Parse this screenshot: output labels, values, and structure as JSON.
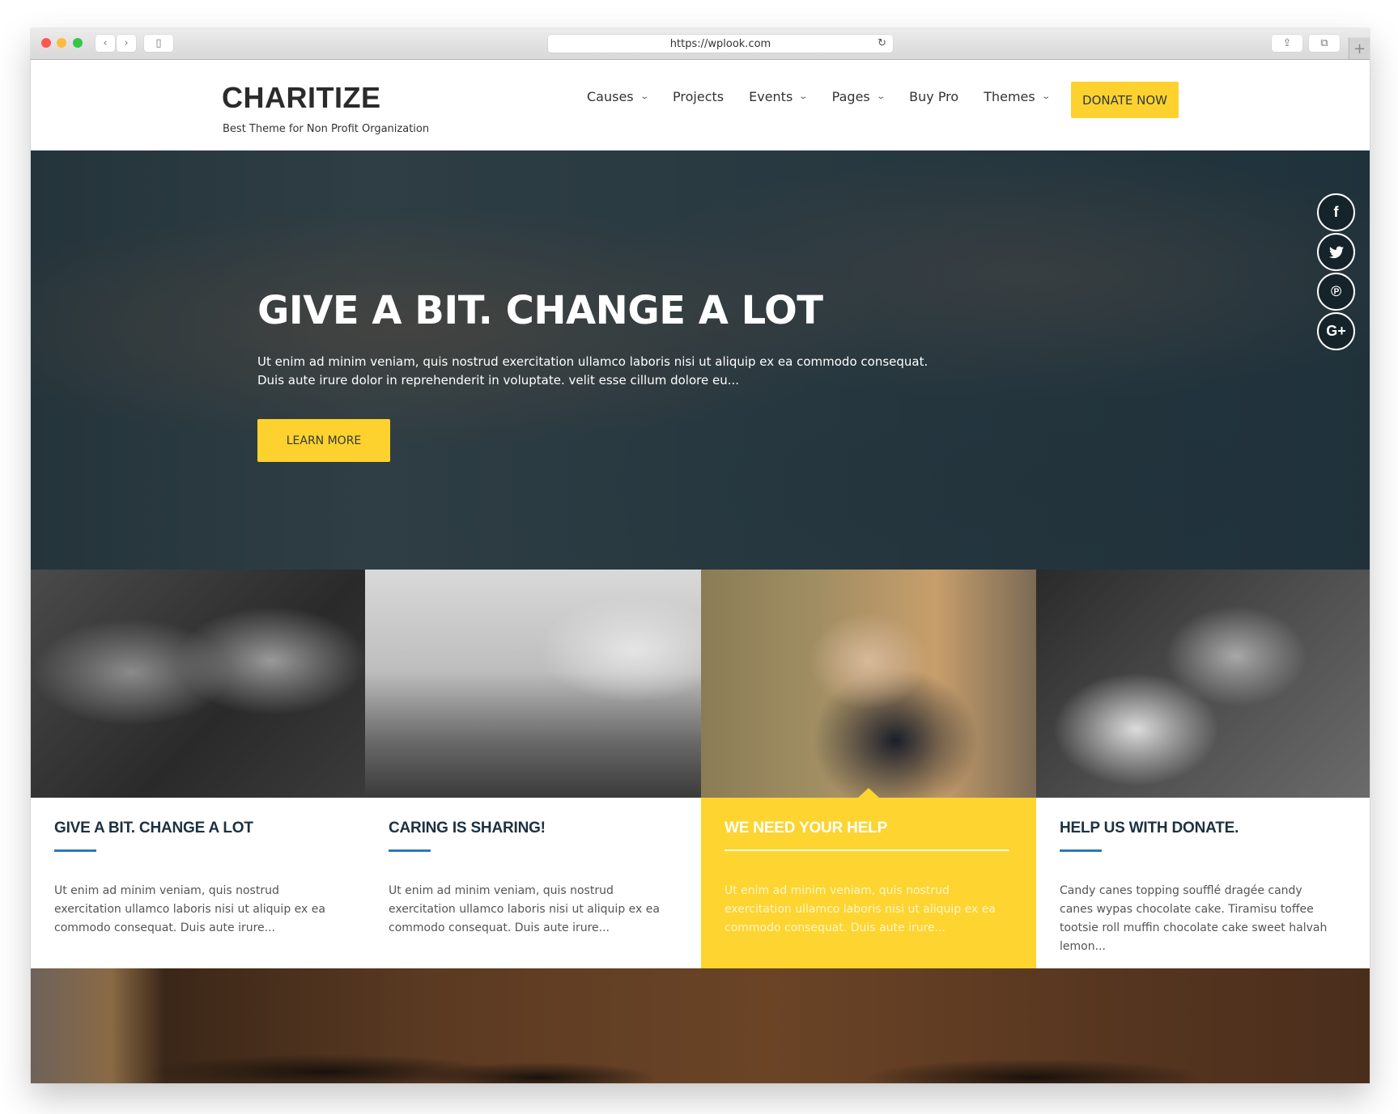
{
  "browser": {
    "url": "https://wplook.com",
    "buttons": {
      "back_icon": "‹",
      "forward_icon": "›",
      "sidebar_icon": "▯",
      "reload_icon": "↻",
      "share_icon": "⇪",
      "tabs_icon": "⧉",
      "new_tab_icon": "+"
    }
  },
  "header": {
    "logo": "CHARITIZE",
    "tagline": "Best Theme for Non Profit Organization",
    "nav": [
      {
        "label": "Causes",
        "has_dropdown": true
      },
      {
        "label": "Projects",
        "has_dropdown": false
      },
      {
        "label": "Events",
        "has_dropdown": true
      },
      {
        "label": "Pages",
        "has_dropdown": true
      },
      {
        "label": "Buy Pro",
        "has_dropdown": false
      },
      {
        "label": "Themes",
        "has_dropdown": true
      }
    ],
    "chevron": "⌄",
    "donate_label": "DONATE NOW"
  },
  "hero": {
    "title": "GIVE A BIT. CHANGE A LOT",
    "text": "Ut enim ad minim veniam, quis nostrud exercitation ullamco laboris nisi ut aliquip ex ea commodo consequat. Duis aute irure dolor in reprehenderit in voluptate. velit esse cillum dolore eu...",
    "button_label": "LEARN MORE",
    "social": [
      {
        "name": "facebook",
        "glyph": "f"
      },
      {
        "name": "twitter",
        "glyph": "🐦"
      },
      {
        "name": "pinterest",
        "glyph": "℗"
      },
      {
        "name": "google-plus",
        "glyph": "G+"
      }
    ]
  },
  "cards": [
    {
      "title": "GIVE A BIT. CHANGE A LOT",
      "text": "Ut enim ad minim veniam, quis nostrud exercitation ullamco laboris nisi ut aliquip ex ea commodo consequat. Duis aute irure...",
      "active": false
    },
    {
      "title": "CARING IS SHARING!",
      "text": "Ut enim ad minim veniam, quis nostrud exercitation ullamco laboris nisi ut aliquip ex ea commodo consequat. Duis aute irure...",
      "active": false
    },
    {
      "title": "WE NEED YOUR HELP",
      "text": "Ut enim ad minim veniam, quis nostrud exercitation ullamco laboris nisi ut aliquip ex ea commodo consequat. Duis aute irure...",
      "active": true
    },
    {
      "title": "HELP US WITH DONATE.",
      "text": "Candy canes topping soufflé dragée candy canes wypas chocolate cake. Tiramisu toffee tootsie roll muffin chocolate cake sweet halvah lemon...",
      "active": false
    }
  ],
  "colors": {
    "accent_yellow": "#fdd22f",
    "heading_navy": "#1c3140",
    "rule_blue": "#2e78bd"
  }
}
